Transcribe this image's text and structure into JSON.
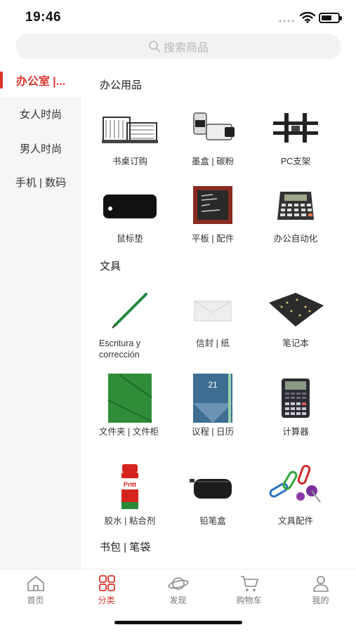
{
  "status_bar": {
    "time": "19:46"
  },
  "search": {
    "placeholder": "搜索商品"
  },
  "sidebar": {
    "items": [
      {
        "label": "办公室 |...",
        "active": true
      },
      {
        "label": "女人时尚",
        "active": false
      },
      {
        "label": "男人时尚",
        "active": false
      },
      {
        "label": "手机 | 数码",
        "active": false
      }
    ]
  },
  "sections": [
    {
      "title": "办公用品",
      "items": [
        {
          "label": "书桌订购",
          "icon": "desk-organizer-icon"
        },
        {
          "label": "墨盒 | 碳粉",
          "icon": "ink-cartridge-icon"
        },
        {
          "label": "PC支架",
          "icon": "monitor-mount-icon"
        },
        {
          "label": "鼠标垫",
          "icon": "mouse-pad-icon"
        },
        {
          "label": "平板 | 配件",
          "icon": "tablet-icon"
        },
        {
          "label": "办公自动化",
          "icon": "calculator-icon"
        }
      ]
    },
    {
      "title": "文具",
      "items": [
        {
          "label": "Escritura y corrección",
          "icon": "pencil-icon"
        },
        {
          "label": "信封 | 纸",
          "icon": "envelope-icon"
        },
        {
          "label": "笔记本",
          "icon": "notebook-icon"
        },
        {
          "label": "文件夹 | 文件柜",
          "icon": "folder-icon"
        },
        {
          "label": "议程 | 日历",
          "icon": "agenda-icon"
        },
        {
          "label": "计算器",
          "icon": "scientific-calculator-icon"
        },
        {
          "label": "胶水 | 粘合剂",
          "icon": "glue-stick-icon"
        },
        {
          "label": "铅笔盒",
          "icon": "pencil-case-icon"
        },
        {
          "label": "文具配件",
          "icon": "paper-clip-icon"
        }
      ]
    },
    {
      "title": "书包 | 笔袋",
      "items": []
    }
  ],
  "tabbar": {
    "items": [
      {
        "label": "首页",
        "icon": "home-icon",
        "active": false
      },
      {
        "label": "分类",
        "icon": "category-icon",
        "active": true
      },
      {
        "label": "发现",
        "icon": "planet-icon",
        "active": false
      },
      {
        "label": "购物车",
        "icon": "cart-icon",
        "active": false
      },
      {
        "label": "我的",
        "icon": "user-icon",
        "active": false
      }
    ]
  },
  "colors": {
    "accent": "#d9342b",
    "sidebar_bg": "#f6f6f6",
    "search_bg": "#f2f2f2"
  }
}
